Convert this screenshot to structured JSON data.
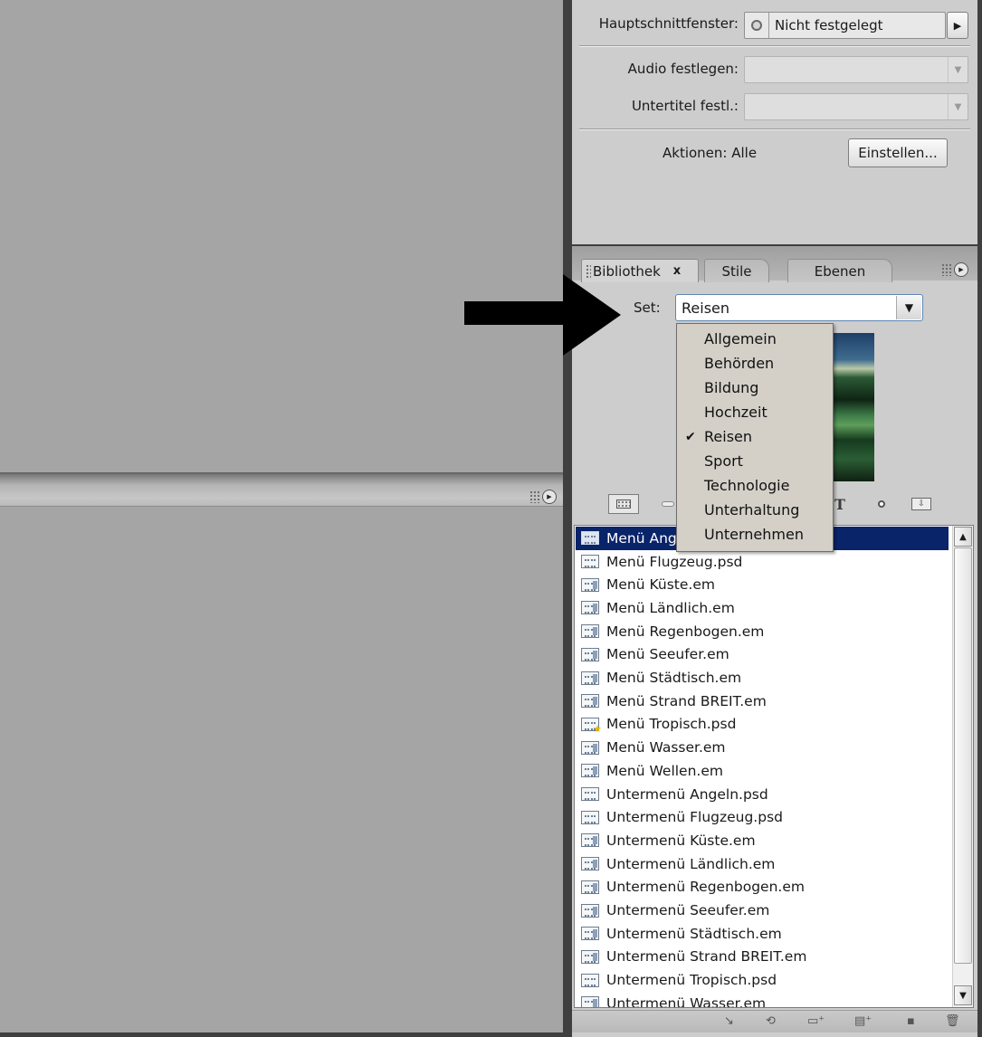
{
  "properties": {
    "main_timeline_label": "Hauptschnittfenster:",
    "main_timeline_value": "Nicht festgelegt",
    "audio_label": "Audio festlegen:",
    "subtitle_label": "Untertitel festl.:",
    "actions_label": "Aktionen: Alle",
    "configure_button": "Einstellen..."
  },
  "library": {
    "tabs": [
      {
        "label": "Bibliothek",
        "active": true,
        "close": "x"
      },
      {
        "label": "Stile",
        "active": false
      },
      {
        "label": "Ebenen",
        "active": false
      }
    ],
    "set_label": "Set:",
    "set_value": "Reisen",
    "set_options": [
      {
        "label": "Allgemein",
        "checked": false
      },
      {
        "label": "Behörden",
        "checked": false
      },
      {
        "label": "Bildung",
        "checked": false
      },
      {
        "label": "Hochzeit",
        "checked": false
      },
      {
        "label": "Reisen",
        "checked": true
      },
      {
        "label": "Sport",
        "checked": false
      },
      {
        "label": "Technologie",
        "checked": false
      },
      {
        "label": "Unterhaltung",
        "checked": false
      },
      {
        "label": "Unternehmen",
        "checked": false
      }
    ],
    "check_glyph": "✔",
    "toolbar_icons": [
      "menu-type-icon",
      "text-icon",
      "graphic-icon",
      "export-icon"
    ],
    "items": [
      {
        "name": "Menü Ang",
        "icon": "psd",
        "selected": true
      },
      {
        "name": "Menü Flugzeug.psd",
        "icon": "psd"
      },
      {
        "name": "Menü Küste.em",
        "icon": "em"
      },
      {
        "name": "Menü Ländlich.em",
        "icon": "em"
      },
      {
        "name": "Menü Regenbogen.em",
        "icon": "em"
      },
      {
        "name": "Menü Seeufer.em",
        "icon": "em"
      },
      {
        "name": "Menü Städtisch.em",
        "icon": "em"
      },
      {
        "name": "Menü Strand BREIT.em",
        "icon": "em"
      },
      {
        "name": "Menü Tropisch.psd",
        "icon": "star"
      },
      {
        "name": "Menü Wasser.em",
        "icon": "em"
      },
      {
        "name": "Menü Wellen.em",
        "icon": "em"
      },
      {
        "name": "Untermenü Angeln.psd",
        "icon": "psd"
      },
      {
        "name": "Untermenü Flugzeug.psd",
        "icon": "psd"
      },
      {
        "name": "Untermenü Küste.em",
        "icon": "em"
      },
      {
        "name": "Untermenü Ländlich.em",
        "icon": "em"
      },
      {
        "name": "Untermenü Regenbogen.em",
        "icon": "em"
      },
      {
        "name": "Untermenü Seeufer.em",
        "icon": "em"
      },
      {
        "name": "Untermenü Städtisch.em",
        "icon": "em"
      },
      {
        "name": "Untermenü Strand BREIT.em",
        "icon": "em"
      },
      {
        "name": "Untermenü Tropisch.psd",
        "icon": "psd"
      },
      {
        "name": "Untermenü Wasser.em",
        "icon": "em"
      }
    ]
  },
  "colors": {
    "selection": "#0a246a",
    "panel_bg": "#cdcdcd",
    "workspace_bg": "#a5a5a5",
    "annotation_arrow": "#000000"
  }
}
